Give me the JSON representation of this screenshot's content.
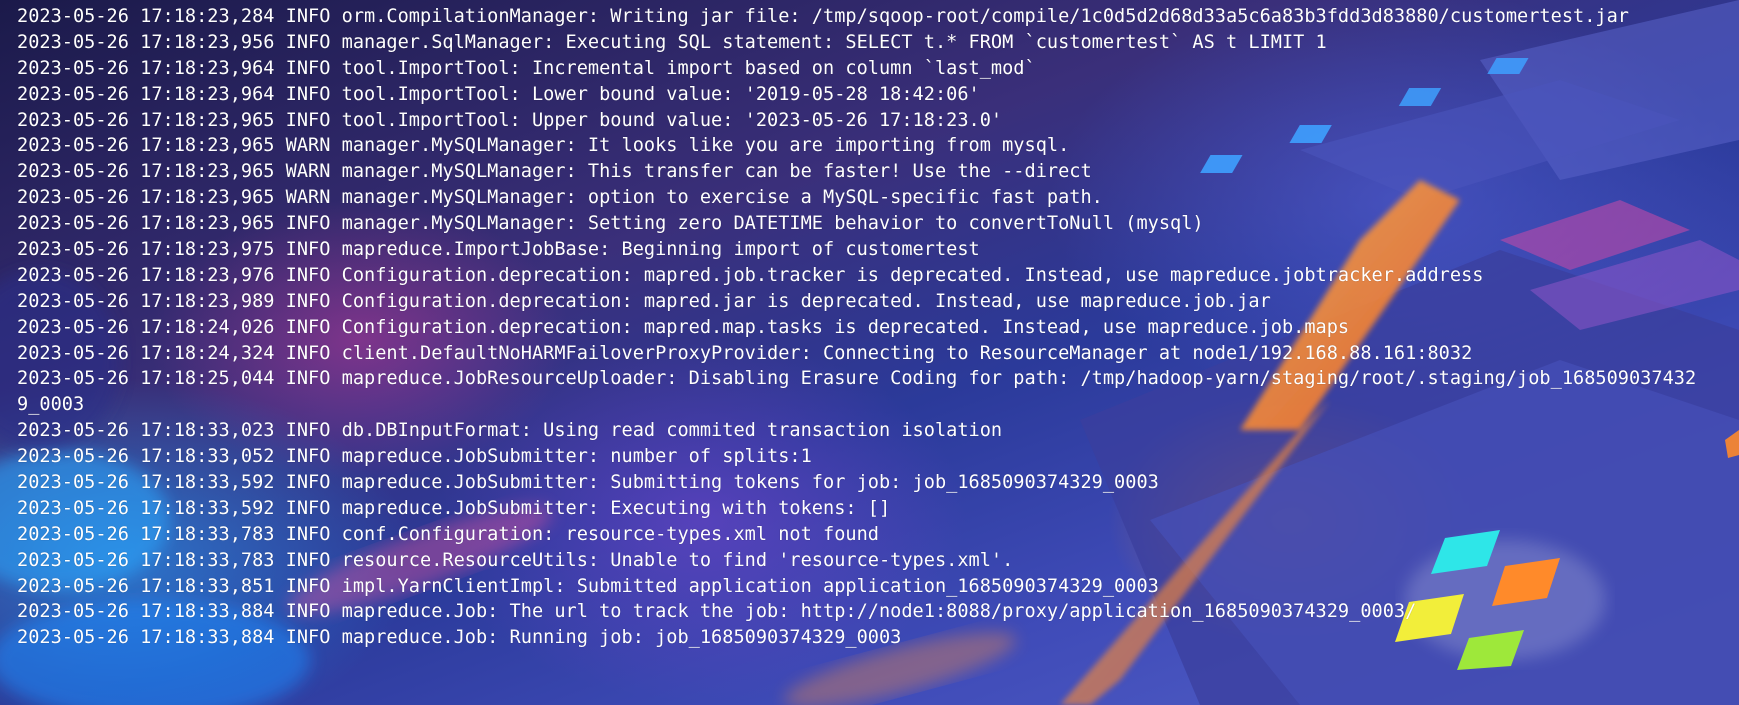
{
  "terminal": {
    "lines": [
      "2023-05-26 17:18:23,284 INFO orm.CompilationManager: Writing jar file: /tmp/sqoop-root/compile/1c0d5d2d68d33a5c6a83b3fdd3d83880/customertest.jar",
      "2023-05-26 17:18:23,956 INFO manager.SqlManager: Executing SQL statement: SELECT t.* FROM `customertest` AS t LIMIT 1",
      "2023-05-26 17:18:23,964 INFO tool.ImportTool: Incremental import based on column `last_mod`",
      "2023-05-26 17:18:23,964 INFO tool.ImportTool: Lower bound value: '2019-05-28 18:42:06'",
      "2023-05-26 17:18:23,965 INFO tool.ImportTool: Upper bound value: '2023-05-26 17:18:23.0'",
      "2023-05-26 17:18:23,965 WARN manager.MySQLManager: It looks like you are importing from mysql.",
      "2023-05-26 17:18:23,965 WARN manager.MySQLManager: This transfer can be faster! Use the --direct",
      "2023-05-26 17:18:23,965 WARN manager.MySQLManager: option to exercise a MySQL-specific fast path.",
      "2023-05-26 17:18:23,965 INFO manager.MySQLManager: Setting zero DATETIME behavior to convertToNull (mysql)",
      "2023-05-26 17:18:23,975 INFO mapreduce.ImportJobBase: Beginning import of customertest",
      "2023-05-26 17:18:23,976 INFO Configuration.deprecation: mapred.job.tracker is deprecated. Instead, use mapreduce.jobtracker.address",
      "2023-05-26 17:18:23,989 INFO Configuration.deprecation: mapred.jar is deprecated. Instead, use mapreduce.job.jar",
      "2023-05-26 17:18:24,026 INFO Configuration.deprecation: mapred.map.tasks is deprecated. Instead, use mapreduce.job.maps",
      "2023-05-26 17:18:24,324 INFO client.DefaultNoHARMFailoverProxyProvider: Connecting to ResourceManager at node1/192.168.88.161:8032",
      "2023-05-26 17:18:25,044 INFO mapreduce.JobResourceUploader: Disabling Erasure Coding for path: /tmp/hadoop-yarn/staging/root/.staging/job_168509037432",
      "9_0003",
      "2023-05-26 17:18:33,023 INFO db.DBInputFormat: Using read commited transaction isolation",
      "2023-05-26 17:18:33,052 INFO mapreduce.JobSubmitter: number of splits:1",
      "2023-05-26 17:18:33,592 INFO mapreduce.JobSubmitter: Submitting tokens for job: job_1685090374329_0003",
      "2023-05-26 17:18:33,592 INFO mapreduce.JobSubmitter: Executing with tokens: []",
      "2023-05-26 17:18:33,783 INFO conf.Configuration: resource-types.xml not found",
      "2023-05-26 17:18:33,783 INFO resource.ResourceUtils: Unable to find 'resource-types.xml'.",
      "2023-05-26 17:18:33,851 INFO impl.YarnClientImpl: Submitted application application_1685090374329_0003",
      "2023-05-26 17:18:33,884 INFO mapreduce.Job: The url to track the job: http://node1:8088/proxy/application_1685090374329_0003/",
      "2023-05-26 17:18:33,884 INFO mapreduce.Job: Running job: job_1685090374329_0003"
    ]
  },
  "wallpaper": {
    "logo_colors": [
      "#2ee6e8",
      "#ff8a2a",
      "#f2ee3a",
      "#9ee83a"
    ],
    "glow_color": "#ff8a2a",
    "accent_color": "#3ea0ff"
  }
}
